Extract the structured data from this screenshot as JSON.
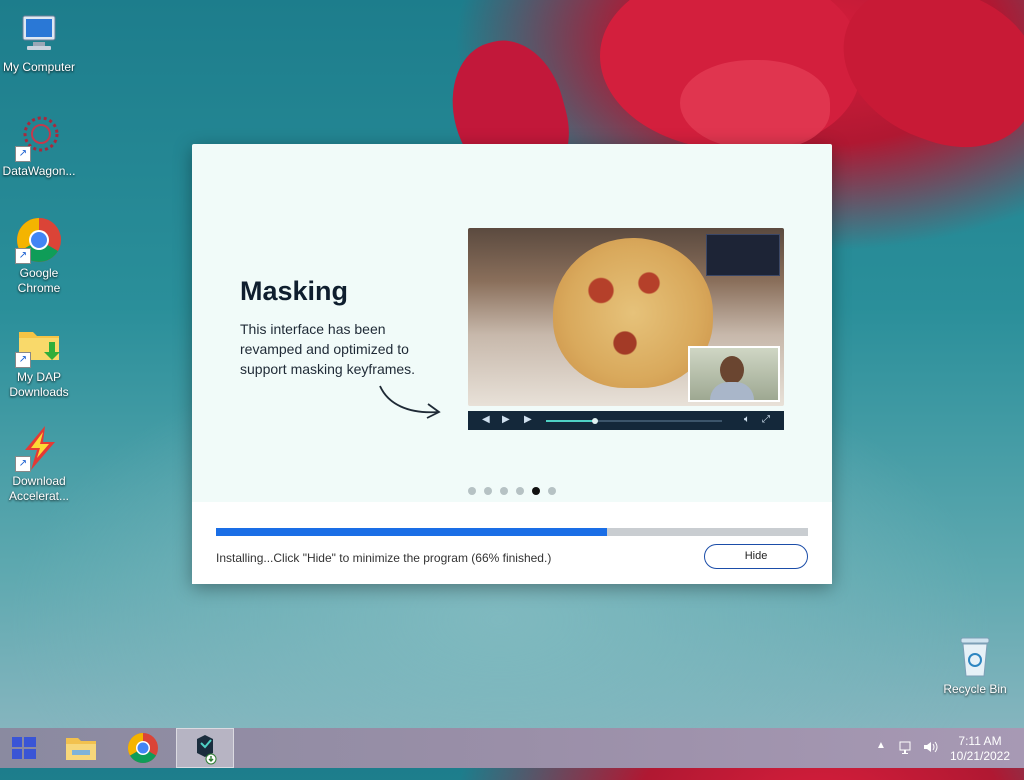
{
  "desktop": {
    "icons": [
      {
        "label": "My Computer",
        "icon": "computer-icon"
      },
      {
        "label": "DataWagon...",
        "icon": "datawagon-icon"
      },
      {
        "label": "Google Chrome",
        "icon": "chrome-icon"
      },
      {
        "label": "My DAP Downloads",
        "icon": "folder-download-icon"
      },
      {
        "label": "Download Accelerat...",
        "icon": "download-accelerator-icon"
      },
      {
        "label": "Recycle Bin",
        "icon": "recycle-bin-icon"
      }
    ]
  },
  "installer": {
    "feature_title": "Masking",
    "feature_description": "This interface has been revamped and optimized to support masking keyframes.",
    "slide_count": 6,
    "active_slide": 5,
    "progress_percent": 66,
    "status_text": "Installing...Click \"Hide\" to minimize the program (66% finished.)",
    "hide_label": "Hide"
  },
  "taskbar": {
    "apps": [
      {
        "name": "start-button",
        "icon": "windows-logo-icon"
      },
      {
        "name": "file-explorer",
        "icon": "folder-icon"
      },
      {
        "name": "chrome",
        "icon": "chrome-icon"
      },
      {
        "name": "installer",
        "icon": "installer-icon",
        "active": true
      }
    ],
    "clock": {
      "time": "7:11 AM",
      "date": "10/21/2022"
    }
  }
}
